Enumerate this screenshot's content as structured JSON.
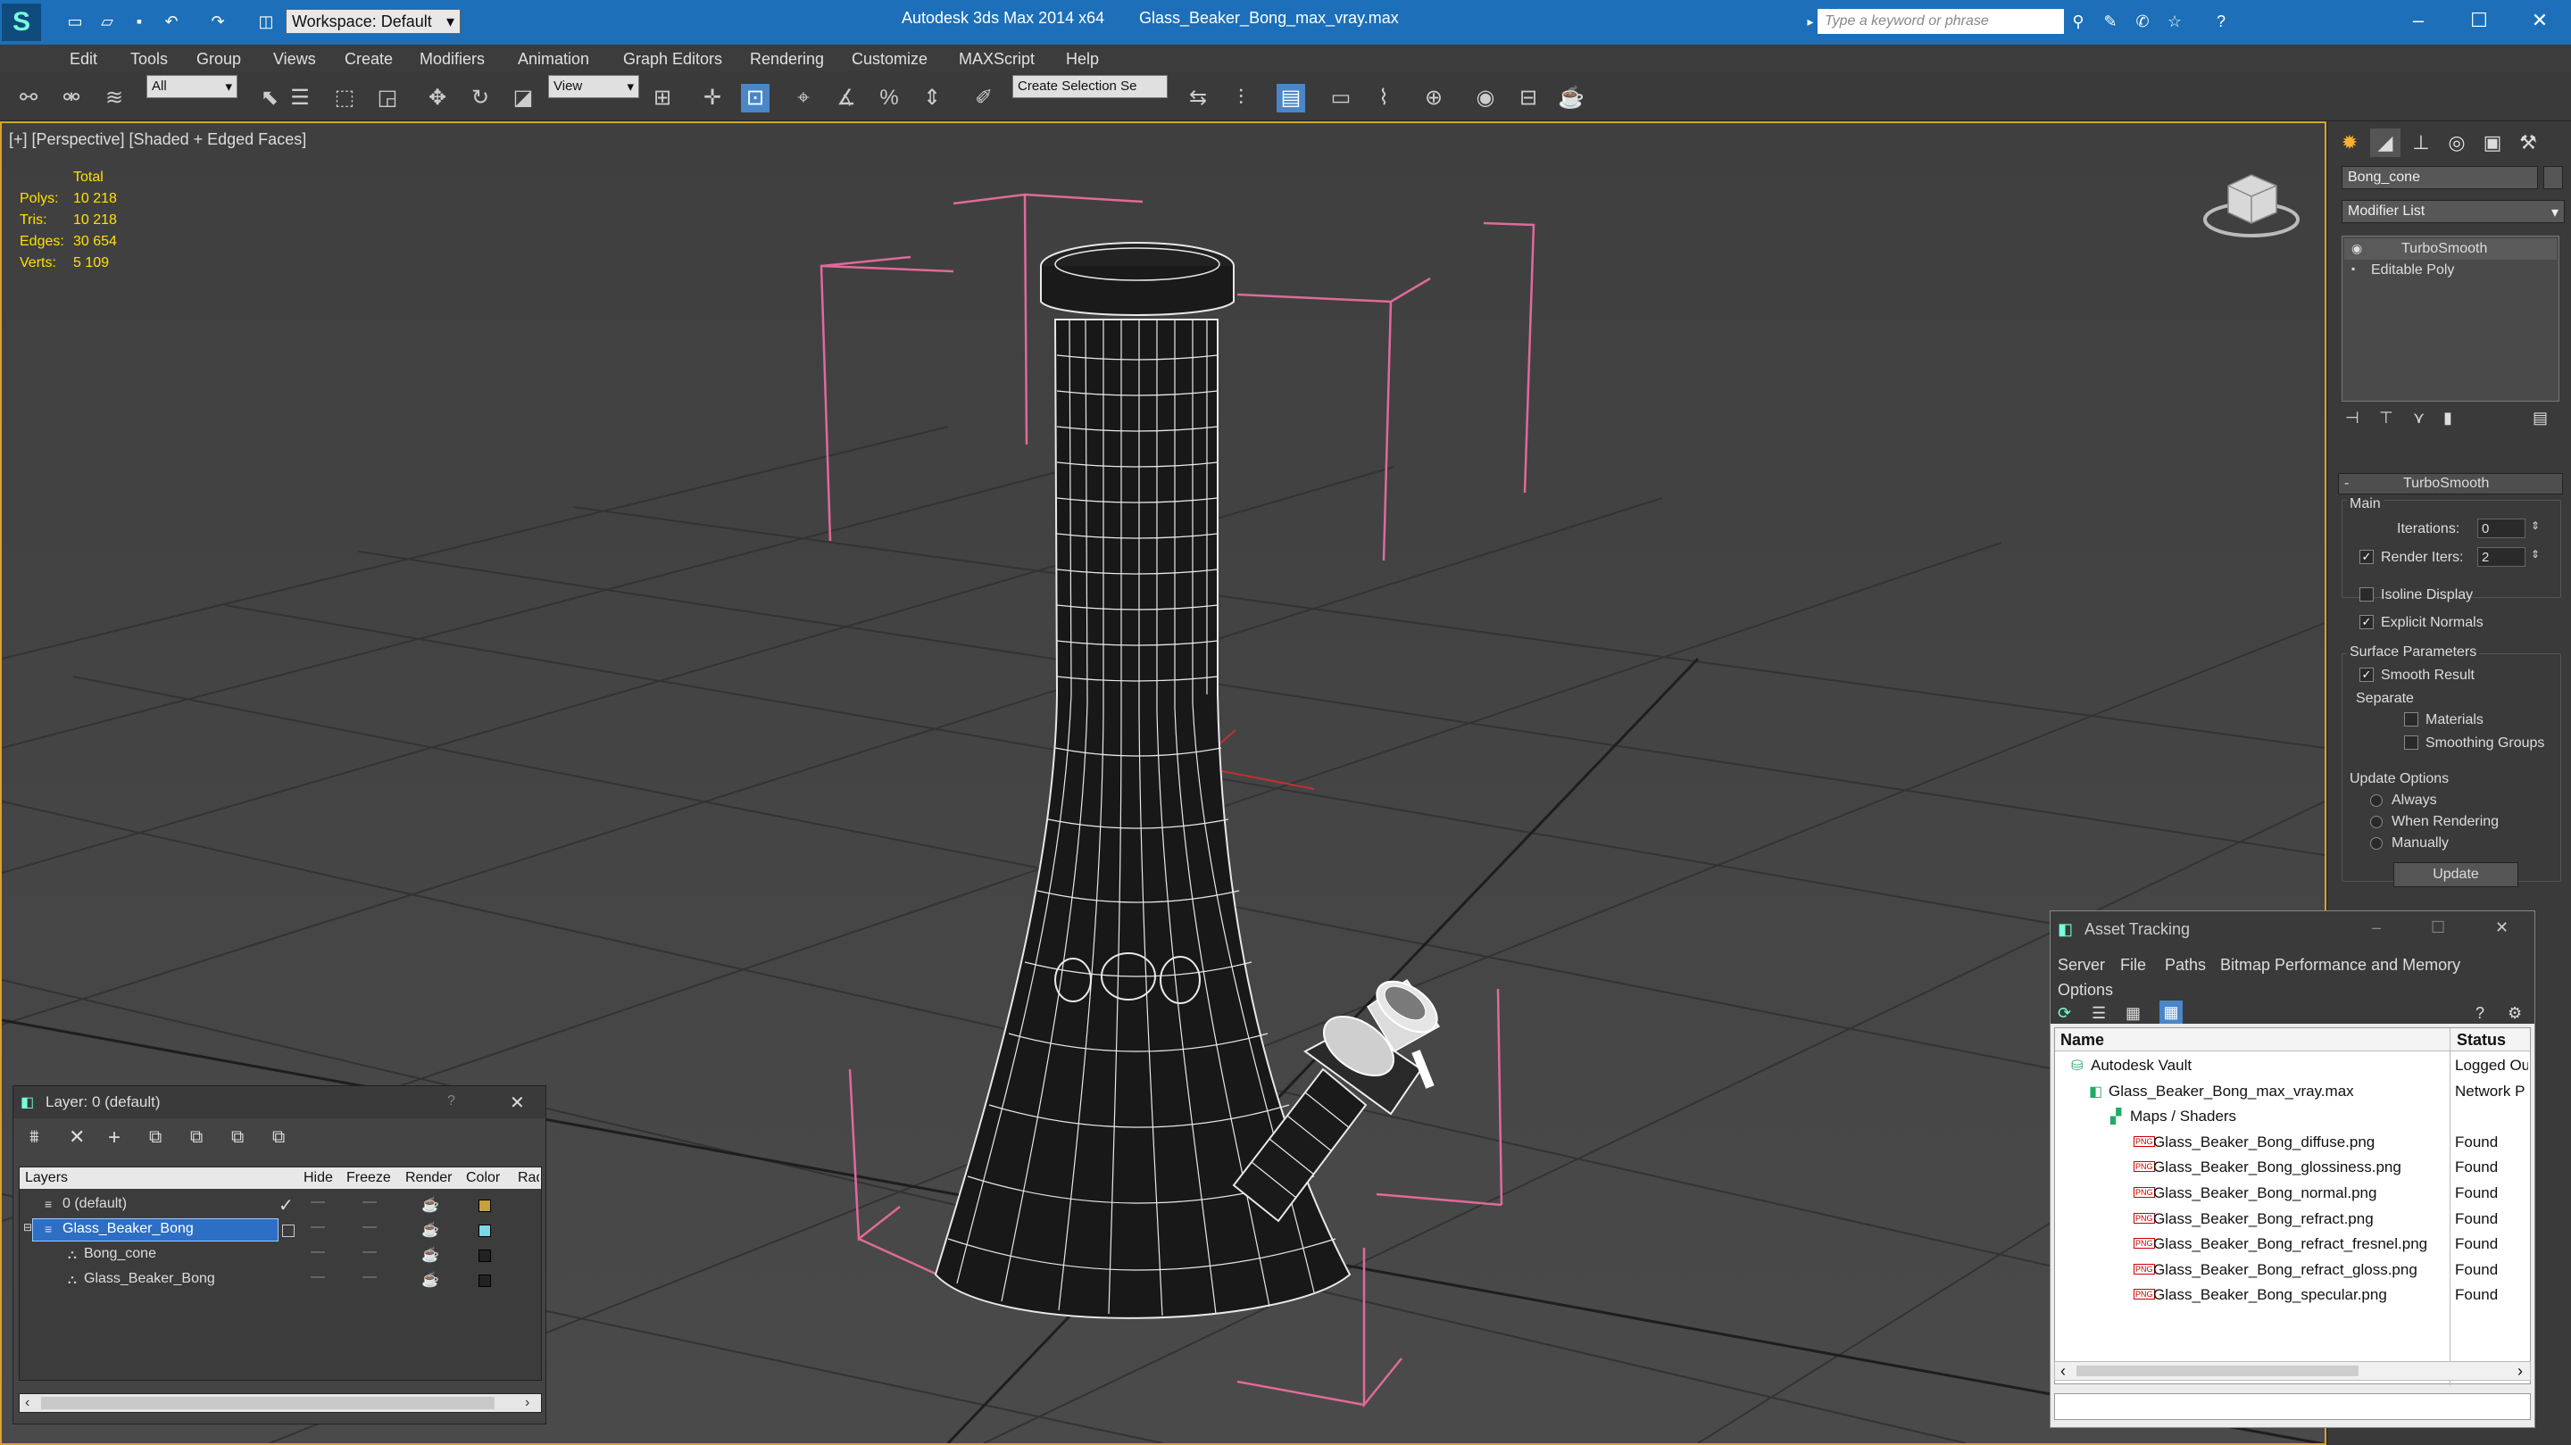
{
  "titlebar": {
    "app_title": "Autodesk 3ds Max  2014 x64",
    "file_title": "Glass_Beaker_Bong_max_vray.max",
    "workspace_label": "Workspace: Default",
    "search_placeholder": "Type a keyword or phrase"
  },
  "menu": [
    "Edit",
    "Tools",
    "Group",
    "Views",
    "Create",
    "Modifiers",
    "Animation",
    "Graph Editors",
    "Rendering",
    "Customize",
    "MAXScript",
    "Help"
  ],
  "toolbar": {
    "selection_filter": "All",
    "ref_coord": "View",
    "selection_set": "Create Selection Se"
  },
  "viewport": {
    "label": "[+] [Perspective] [Shaded + Edged Faces]",
    "stats": {
      "header": "Total",
      "rows": [
        {
          "label": "Polys:",
          "value": "10 218"
        },
        {
          "label": "Tris:",
          "value": "10 218"
        },
        {
          "label": "Edges:",
          "value": "30 654"
        },
        {
          "label": "Verts:",
          "value": "5 109"
        }
      ]
    }
  },
  "command_panel": {
    "object_name": "Bong_cone",
    "modifier_list": "Modifier List",
    "stack": [
      "TurboSmooth",
      "Editable Poly"
    ],
    "rollout_title": "TurboSmooth",
    "main_label": "Main",
    "iterations_label": "Iterations:",
    "iterations_value": "0",
    "render_iters_label": "Render Iters:",
    "render_iters_value": "2",
    "isoline_label": "Isoline Display",
    "explicit_normals_label": "Explicit Normals",
    "surface_params_label": "Surface Parameters",
    "smooth_result_label": "Smooth Result",
    "separate_label": "Separate",
    "materials_label": "Materials",
    "smoothing_groups_label": "Smoothing Groups",
    "update_options_label": "Update Options",
    "always_label": "Always",
    "when_rendering_label": "When Rendering",
    "manually_label": "Manually",
    "update_button": "Update"
  },
  "layer_panel": {
    "title": "Layer: 0 (default)",
    "help": "?",
    "columns": [
      "Layers",
      "Hide",
      "Freeze",
      "Render",
      "Color",
      "Rad"
    ],
    "rows": [
      {
        "name": "0 (default)",
        "color": "#c8a040"
      },
      {
        "name": "Glass_Beaker_Bong",
        "color": "#7ad8e8"
      },
      {
        "name": "Bong_cone",
        "color": "#222222"
      },
      {
        "name": "Glass_Beaker_Bong",
        "color": "#222222"
      }
    ]
  },
  "asset_tracking": {
    "title": "Asset Tracking",
    "menu": [
      "Server",
      "File",
      "Paths",
      "Bitmap Performance and Memory",
      "Options"
    ],
    "col_name": "Name",
    "col_status": "Status",
    "rows": [
      {
        "name": "Autodesk Vault",
        "status": "Logged Ou"
      },
      {
        "name": "Glass_Beaker_Bong_max_vray.max",
        "status": "Network P"
      },
      {
        "name": "Maps / Shaders",
        "status": ""
      },
      {
        "name": "Glass_Beaker_Bong_diffuse.png",
        "status": "Found"
      },
      {
        "name": "Glass_Beaker_Bong_glossiness.png",
        "status": "Found"
      },
      {
        "name": "Glass_Beaker_Bong_normal.png",
        "status": "Found"
      },
      {
        "name": "Glass_Beaker_Bong_refract.png",
        "status": "Found"
      },
      {
        "name": "Glass_Beaker_Bong_refract_fresnel.png",
        "status": "Found"
      },
      {
        "name": "Glass_Beaker_Bong_refract_gloss.png",
        "status": "Found"
      },
      {
        "name": "Glass_Beaker_Bong_specular.png",
        "status": "Found"
      }
    ]
  },
  "colors": {
    "title_bar": "#1c6fb8",
    "viewport_border": "#d9a32e",
    "stats_text": "#ffe000",
    "layer_selected": "#2d6fc4"
  }
}
